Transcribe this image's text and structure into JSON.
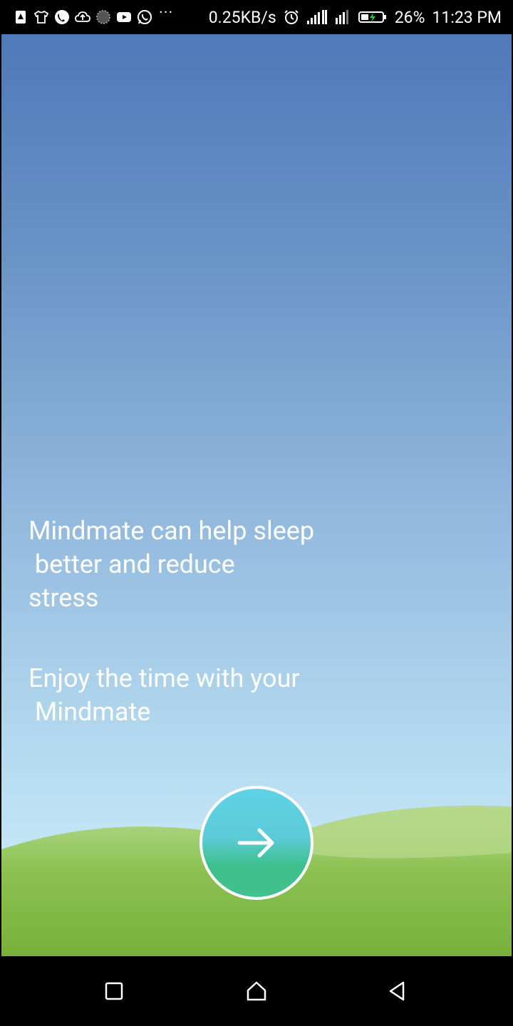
{
  "status_bar": {
    "left_icons": [
      "sim-alert-icon",
      "tshirt-icon",
      "phone-call-icon",
      "cloud-upload-icon",
      "loading-spinner-icon",
      "youtube-icon",
      "whatsapp-icon"
    ],
    "more_dots": "···",
    "network_speed": "0.25KB/s",
    "right_icons": [
      "alarm-icon",
      "signal-bars-icon",
      "signal-bars-2-icon",
      "battery-charging-icon"
    ],
    "battery_percent": "26%",
    "time": "11:23 PM"
  },
  "main": {
    "message_1": "Mindmate can help sleep\n better and reduce\nstress",
    "message_2": "Enjoy the time with your\n Mindmate",
    "next_button_icon": "arrow-right-icon"
  },
  "colors": {
    "sky_top": "#4f79b8",
    "sky_bottom": "#c6e9f6",
    "grass": "#7db33d",
    "button_top": "#5fd2e6",
    "button_bottom": "#41c18c"
  },
  "nav_bar": {
    "icons": [
      "recents-square-icon",
      "home-icon",
      "back-triangle-icon"
    ]
  }
}
